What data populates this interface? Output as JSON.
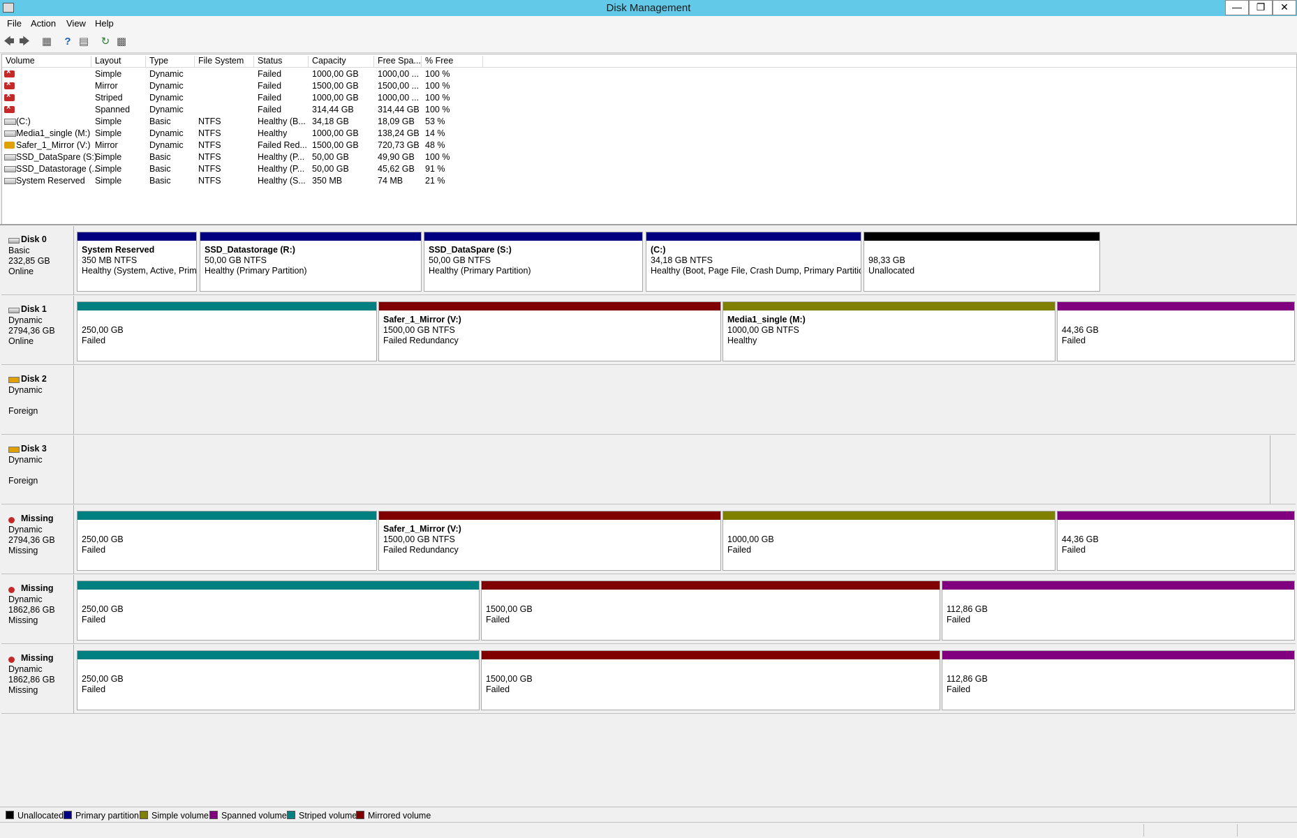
{
  "window": {
    "title": "Disk Management"
  },
  "menu": [
    "File",
    "Action",
    "View",
    "Help"
  ],
  "colors": {
    "unallocated": "#000000",
    "primary": "#000080",
    "simple": "#808000",
    "spanned": "#800080",
    "striped": "#008080",
    "mirrored": "#800000"
  },
  "volume_list": {
    "columns": [
      "Volume",
      "Layout",
      "Type",
      "File System",
      "Status",
      "Capacity",
      "Free Spa...",
      "% Free"
    ],
    "rows": [
      {
        "icon": "failed-volume-icon",
        "volume": "",
        "layout": "Simple",
        "type": "Dynamic",
        "fs": "",
        "status": "Failed",
        "capacity": "1000,00 GB",
        "free": "1000,00 ...",
        "pct": "100 %"
      },
      {
        "icon": "failed-volume-icon",
        "volume": "",
        "layout": "Mirror",
        "type": "Dynamic",
        "fs": "",
        "status": "Failed",
        "capacity": "1500,00 GB",
        "free": "1500,00 ...",
        "pct": "100 %"
      },
      {
        "icon": "failed-volume-icon",
        "volume": "",
        "layout": "Striped",
        "type": "Dynamic",
        "fs": "",
        "status": "Failed",
        "capacity": "1000,00 GB",
        "free": "1000,00 ...",
        "pct": "100 %"
      },
      {
        "icon": "failed-volume-icon",
        "volume": "",
        "layout": "Spanned",
        "type": "Dynamic",
        "fs": "",
        "status": "Failed",
        "capacity": "314,44 GB",
        "free": "314,44 GB",
        "pct": "100 %"
      },
      {
        "icon": "disk-volume-icon",
        "volume": "(C:)",
        "layout": "Simple",
        "type": "Basic",
        "fs": "NTFS",
        "status": "Healthy (B...",
        "capacity": "34,18 GB",
        "free": "18,09 GB",
        "pct": "53 %"
      },
      {
        "icon": "disk-volume-icon",
        "volume": "Media1_single (M:)",
        "layout": "Simple",
        "type": "Dynamic",
        "fs": "NTFS",
        "status": "Healthy",
        "capacity": "1000,00 GB",
        "free": "138,24 GB",
        "pct": "14 %"
      },
      {
        "icon": "warning-volume-icon",
        "volume": "Safer_1_Mirror (V:)",
        "layout": "Mirror",
        "type": "Dynamic",
        "fs": "NTFS",
        "status": "Failed Red...",
        "capacity": "1500,00 GB",
        "free": "720,73 GB",
        "pct": "48 %"
      },
      {
        "icon": "disk-volume-icon",
        "volume": "SSD_DataSpare (S:)",
        "layout": "Simple",
        "type": "Basic",
        "fs": "NTFS",
        "status": "Healthy (P...",
        "capacity": "50,00 GB",
        "free": "49,90 GB",
        "pct": "100 %"
      },
      {
        "icon": "disk-volume-icon",
        "volume": "SSD_Datastorage (...",
        "layout": "Simple",
        "type": "Basic",
        "fs": "NTFS",
        "status": "Healthy (P...",
        "capacity": "50,00 GB",
        "free": "45,62 GB",
        "pct": "91 %"
      },
      {
        "icon": "disk-volume-icon",
        "volume": "System Reserved",
        "layout": "Simple",
        "type": "Basic",
        "fs": "NTFS",
        "status": "Healthy (S...",
        "capacity": "350 MB",
        "free": "74 MB",
        "pct": "21 %"
      }
    ]
  },
  "disks": [
    {
      "name": "Disk 0",
      "icon": "disk-icon",
      "lines": [
        "Basic",
        "232,85 GB",
        "Online"
      ],
      "parts": [
        {
          "kind": "primary",
          "title": "System Reserved",
          "size": "350 MB NTFS",
          "status": "Healthy (System, Active, Prim"
        },
        {
          "kind": "primary",
          "title": "SSD_Datastorage  (R:)",
          "size": "50,00 GB NTFS",
          "status": "Healthy (Primary Partition)"
        },
        {
          "kind": "primary",
          "title": "SSD_DataSpare  (S:)",
          "size": "50,00 GB NTFS",
          "status": "Healthy (Primary Partition)"
        },
        {
          "kind": "primary",
          "title": "(C:)",
          "size": "34,18 GB NTFS",
          "status": "Healthy (Boot, Page File, Crash Dump, Primary Partition"
        },
        {
          "kind": "unallocated",
          "title": "",
          "size": "98,33 GB",
          "status": "Unallocated"
        }
      ]
    },
    {
      "name": "Disk 1",
      "icon": "disk-icon",
      "lines": [
        "Dynamic",
        "2794,36 GB",
        "Online"
      ],
      "parts": [
        {
          "kind": "striped",
          "title": "",
          "size": "250,00 GB",
          "status": "Failed"
        },
        {
          "kind": "mirrored",
          "title": "Safer_1_Mirror  (V:)",
          "size": "1500,00 GB NTFS",
          "status": "Failed Redundancy"
        },
        {
          "kind": "simple",
          "title": "Media1_single  (M:)",
          "size": "1000,00 GB NTFS",
          "status": "Healthy"
        },
        {
          "kind": "spanned",
          "title": "",
          "size": "44,36 GB",
          "status": "Failed"
        }
      ]
    },
    {
      "name": "Disk 2",
      "icon": "foreign-disk-icon",
      "lines": [
        "Dynamic",
        "",
        "Foreign"
      ],
      "parts": []
    },
    {
      "name": "Disk 3",
      "icon": "foreign-disk-icon",
      "lines": [
        "Dynamic",
        "",
        "Foreign"
      ],
      "parts": []
    },
    {
      "name": "Missing",
      "icon": "missing-disk-icon",
      "lines": [
        "Dynamic",
        "2794,36 GB",
        "Missing"
      ],
      "parts": [
        {
          "kind": "striped",
          "title": "",
          "size": "250,00 GB",
          "status": "Failed"
        },
        {
          "kind": "mirrored",
          "title": "Safer_1_Mirror  (V:)",
          "size": "1500,00 GB NTFS",
          "status": "Failed Redundancy"
        },
        {
          "kind": "simple",
          "title": "",
          "size": "1000,00 GB",
          "status": "Failed"
        },
        {
          "kind": "spanned",
          "title": "",
          "size": "44,36 GB",
          "status": "Failed"
        }
      ]
    },
    {
      "name": "Missing",
      "icon": "missing-disk-icon",
      "lines": [
        "Dynamic",
        "1862,86 GB",
        "Missing"
      ],
      "parts": [
        {
          "kind": "striped",
          "title": "",
          "size": "250,00 GB",
          "status": "Failed"
        },
        {
          "kind": "mirrored",
          "title": "",
          "size": "1500,00 GB",
          "status": "Failed"
        },
        {
          "kind": "spanned",
          "title": "",
          "size": "112,86 GB",
          "status": "Failed"
        }
      ]
    },
    {
      "name": "Missing",
      "icon": "missing-disk-icon",
      "lines": [
        "Dynamic",
        "1862,86 GB",
        "Missing"
      ],
      "parts": [
        {
          "kind": "striped",
          "title": "",
          "size": "250,00 GB",
          "status": "Failed"
        },
        {
          "kind": "mirrored",
          "title": "",
          "size": "1500,00 GB",
          "status": "Failed"
        },
        {
          "kind": "spanned",
          "title": "",
          "size": "112,86 GB",
          "status": "Failed"
        }
      ]
    }
  ],
  "legend": [
    {
      "kind": "unallocated",
      "label": "Unallocated"
    },
    {
      "kind": "primary",
      "label": "Primary partition"
    },
    {
      "kind": "simple",
      "label": "Simple volume"
    },
    {
      "kind": "spanned",
      "label": "Spanned volume"
    },
    {
      "kind": "striped",
      "label": "Striped volume"
    },
    {
      "kind": "mirrored",
      "label": "Mirrored volume"
    }
  ]
}
